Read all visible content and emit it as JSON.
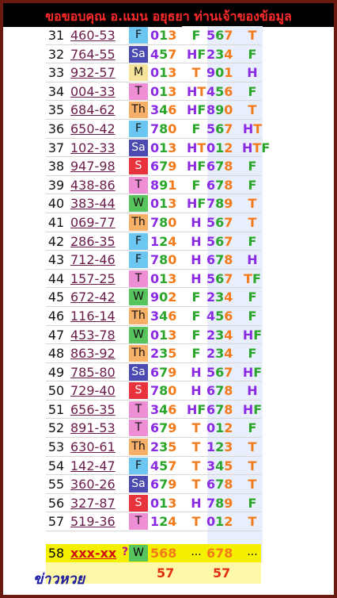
{
  "banner": "ขอขอบคุณ อ.แมน อยุธยา ท่านเจ้าของข้อมูล",
  "rows": [
    {
      "n": "31",
      "num": "460-53",
      "day": "F",
      "dbg": "#6cc6f2",
      "d1": "013",
      "t1": "F",
      "d2": "567",
      "t2": "T"
    },
    {
      "n": "32",
      "num": "764-55",
      "day": "Sa",
      "dbg": "#4a4ab0",
      "d1": "457",
      "t1": "HF",
      "d2": "234",
      "t2": "F"
    },
    {
      "n": "33",
      "num": "932-57",
      "day": "M",
      "dbg": "#f6e39a",
      "d1": "013",
      "t1": "T",
      "d2": "901",
      "t2": "H"
    },
    {
      "n": "34",
      "num": "004-33",
      "day": "T",
      "dbg": "#ee8fd6",
      "d1": "013",
      "t1": "HT",
      "d2": "456",
      "t2": "F"
    },
    {
      "n": "35",
      "num": "684-62",
      "day": "Th",
      "dbg": "#f7b067",
      "d1": "346",
      "t1": "HF",
      "d2": "890",
      "t2": "T"
    },
    {
      "n": "36",
      "num": "650-42",
      "day": "F",
      "dbg": "#6cc6f2",
      "d1": "780",
      "t1": "F",
      "d2": "567",
      "t2": "HT"
    },
    {
      "n": "37",
      "num": "102-33",
      "day": "Sa",
      "dbg": "#4a4ab0",
      "d1": "013",
      "t1": "HT",
      "d2": "012",
      "t2": "HTF"
    },
    {
      "n": "38",
      "num": "947-98",
      "day": "S",
      "dbg": "#e8333c",
      "d1": "679",
      "t1": "HF",
      "d2": "678",
      "t2": "F"
    },
    {
      "n": "39",
      "num": "438-86",
      "day": "T",
      "dbg": "#ee8fd6",
      "d1": "891",
      "t1": "F",
      "d2": "678",
      "t2": "F"
    },
    {
      "n": "40",
      "num": "383-44",
      "day": "W",
      "dbg": "#58c45e",
      "d1": "013",
      "t1": "HF",
      "d2": "789",
      "t2": "T"
    },
    {
      "n": "41",
      "num": "069-77",
      "day": "Th",
      "dbg": "#f7b067",
      "d1": "780",
      "t1": "H",
      "d2": "567",
      "t2": "T"
    },
    {
      "n": "42",
      "num": "286-35",
      "day": "F",
      "dbg": "#6cc6f2",
      "d1": "124",
      "t1": "H",
      "d2": "567",
      "t2": "F"
    },
    {
      "n": "43",
      "num": "712-46",
      "day": "F",
      "dbg": "#6cc6f2",
      "d1": "780",
      "t1": "H",
      "d2": "678",
      "t2": "H"
    },
    {
      "n": "44",
      "num": "157-25",
      "day": "T",
      "dbg": "#ee8fd6",
      "d1": "013",
      "t1": "H",
      "d2": "567",
      "t2": "TF"
    },
    {
      "n": "45",
      "num": "672-42",
      "day": "W",
      "dbg": "#58c45e",
      "d1": "902",
      "t1": "F",
      "d2": "234",
      "t2": "F"
    },
    {
      "n": "46",
      "num": "116-14",
      "day": "Th",
      "dbg": "#f7b067",
      "d1": "346",
      "t1": "F",
      "d2": "456",
      "t2": "F"
    },
    {
      "n": "47",
      "num": "453-78",
      "day": "W",
      "dbg": "#58c45e",
      "d1": "013",
      "t1": "F",
      "d2": "234",
      "t2": "HF"
    },
    {
      "n": "48",
      "num": "863-92",
      "day": "Th",
      "dbg": "#f7b067",
      "d1": "235",
      "t1": "F",
      "d2": "234",
      "t2": "F"
    },
    {
      "n": "49",
      "num": "785-80",
      "day": "Sa",
      "dbg": "#4a4ab0",
      "d1": "679",
      "t1": "H",
      "d2": "567",
      "t2": "HF"
    },
    {
      "n": "50",
      "num": "729-40",
      "day": "S",
      "dbg": "#e8333c",
      "d1": "780",
      "t1": "H",
      "d2": "678",
      "t2": "H"
    },
    {
      "n": "51",
      "num": "656-35",
      "day": "T",
      "dbg": "#ee8fd6",
      "d1": "346",
      "t1": "HF",
      "d2": "678",
      "t2": "HF"
    },
    {
      "n": "52",
      "num": "891-53",
      "day": "T",
      "dbg": "#ee8fd6",
      "d1": "679",
      "t1": "T",
      "d2": "012",
      "t2": "F"
    },
    {
      "n": "53",
      "num": "630-61",
      "day": "Th",
      "dbg": "#f7b067",
      "d1": "235",
      "t1": "T",
      "d2": "123",
      "t2": "T"
    },
    {
      "n": "54",
      "num": "142-47",
      "day": "F",
      "dbg": "#6cc6f2",
      "d1": "457",
      "t1": "T",
      "d2": "345",
      "t2": "T"
    },
    {
      "n": "55",
      "num": "360-26",
      "day": "Sa",
      "dbg": "#4a4ab0",
      "d1": "679",
      "t1": "T",
      "d2": "678",
      "t2": "T"
    },
    {
      "n": "56",
      "num": "327-87",
      "day": "S",
      "dbg": "#e8333c",
      "d1": "013",
      "t1": "H",
      "d2": "789",
      "t2": "F"
    },
    {
      "n": "57",
      "num": "519-36",
      "day": "T",
      "dbg": "#ee8fd6",
      "d1": "124",
      "t1": "T",
      "d2": "012",
      "t2": "T"
    }
  ],
  "last": {
    "n": "58",
    "num": "xxx-xx",
    "q": "?",
    "day": "W",
    "d1": "568",
    "e1": "...",
    "d2": "678",
    "e2": "..."
  },
  "last2": {
    "a": "57",
    "b": "57"
  },
  "logo": "ข่าวหวย",
  "colors": {
    "H": "#8a2be2",
    "T": "#f27a1a",
    "F": "#2aa62a"
  }
}
